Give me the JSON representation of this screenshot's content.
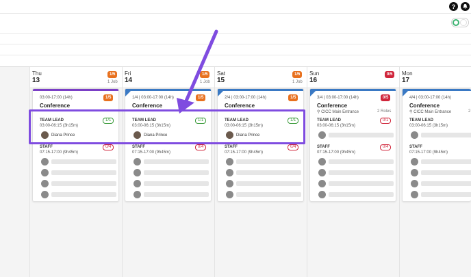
{
  "topbar": {
    "help_icon": "?",
    "bell_icon": "bell-icon"
  },
  "days": [
    {
      "name": "Thu",
      "num": "13",
      "badge": "1/5",
      "badge_color": "#e8711f",
      "jobs": "1 Job",
      "card": {
        "time": "03:00-17:00 (14h)",
        "badge": "1/5",
        "title": "Conference",
        "location": "",
        "roles": "",
        "lead_label": "TEAM LEAD",
        "lead_frac": "1/1",
        "lead_time": "03:00-06:15 (3h15m)",
        "lead_name": "Diana Prince",
        "staff_label": "STAFF",
        "staff_frac": "0/4",
        "staff_time": "07:15-17:00 (9h45m)"
      }
    },
    {
      "name": "Fri",
      "num": "14",
      "badge": "1/5",
      "badge_color": "#e8711f",
      "jobs": "1 Job",
      "card": {
        "time": "1/4 | 03:00-17:00 (14h)",
        "badge": "1/5",
        "title": "Conference",
        "location": "",
        "roles": "",
        "lead_label": "TEAM LEAD",
        "lead_frac": "1/1",
        "lead_time": "03:00-06:15 (3h15m)",
        "lead_name": "Diana Prince",
        "staff_label": "STAFF",
        "staff_frac": "0/4",
        "staff_time": "07:15-17:00 (9h45m)"
      }
    },
    {
      "name": "Sat",
      "num": "15",
      "badge": "1/5",
      "badge_color": "#e8711f",
      "jobs": "1 Job",
      "card": {
        "time": "2/4 | 03:00-17:00 (14h)",
        "badge": "1/5",
        "title": "Conference",
        "location": "",
        "roles": "",
        "lead_label": "TEAM LEAD",
        "lead_frac": "1/1",
        "lead_time": "03:00-06:15 (3h15m)",
        "lead_name": "Diana Prince",
        "staff_label": "STAFF",
        "staff_frac": "0/4",
        "staff_time": "07:15-17:00 (9h45m)"
      }
    },
    {
      "name": "Sun",
      "num": "16",
      "badge": "0/5",
      "badge_color": "#d0263b",
      "jobs": "",
      "card": {
        "time": "3/4 | 03:00-17:00 (14h)",
        "badge": "0/5",
        "title": "Conference",
        "location": "CICC Main Entrance",
        "roles": "2 Roles",
        "lead_label": "TEAM LEAD",
        "lead_frac": "0/1",
        "lead_time": "03:00-06:15 (3h15m)",
        "lead_name": "",
        "staff_label": "STAFF",
        "staff_frac": "0/4",
        "staff_time": "07:15-17:00 (9h45m)"
      }
    },
    {
      "name": "Mon",
      "num": "17",
      "badge": "",
      "badge_color": "#d0263b",
      "jobs": "",
      "card": {
        "time": "4/4 | 03:00-17:00 (14h)",
        "badge": "",
        "title": "Conference",
        "location": "CICC Main Entrance",
        "roles": "2",
        "lead_label": "TEAM LEAD",
        "lead_frac": "",
        "lead_time": "03:00-06:15 (3h15m)",
        "lead_name": "",
        "staff_label": "STAFF",
        "staff_frac": "",
        "staff_time": "07:15-17:00 (9h45m)"
      }
    }
  ],
  "colors": {
    "accent_purple": "#7f4ce0",
    "orange": "#e8711f",
    "red": "#d0263b",
    "green": "#3a9b3a",
    "card_top_purple": "#7b3fc6",
    "card_top_blue": "#3a79c4"
  }
}
